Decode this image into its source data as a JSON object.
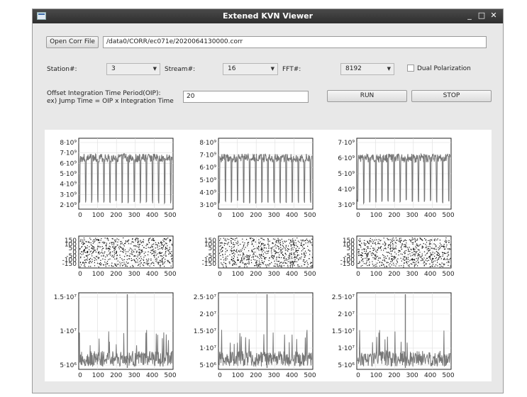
{
  "window": {
    "title": "Extened KVN Viewer"
  },
  "window_controls": {
    "minimize": "_",
    "maximize": "□",
    "close": "✕"
  },
  "toolbar": {
    "open_label": "Open Corr File",
    "file_path": "/data0/CORR/ec071e/2020064130000.corr"
  },
  "settings": {
    "station_label": "Station#:",
    "station_value": "3",
    "stream_label": "Stream#:",
    "stream_value": "16",
    "fft_label": "FFT#:",
    "fft_value": "8192",
    "dual_pol_label": "Dual Polarization",
    "dual_pol_checked": false
  },
  "oip": {
    "label_line1": "Offset Integration Time Period(OIP):",
    "label_line2": "ex) Jump Time = OIP x Integration Time",
    "value": "20",
    "run_label": "RUN",
    "stop_label": "STOP"
  },
  "plots": {
    "x_ticks": [
      "0",
      "100",
      "200",
      "300",
      "400",
      "500"
    ],
    "row1": [
      {
        "y_ticks": [
          "8·10⁹",
          "7·10⁹",
          "6·10⁹",
          "5·10⁹",
          "4·10⁹",
          "3·10⁹",
          "2·10⁹"
        ]
      },
      {
        "y_ticks": [
          "8·10⁹",
          "7·10⁹",
          "6·10⁹",
          "5·10⁹",
          "4·10⁹",
          "3·10⁹"
        ]
      },
      {
        "y_ticks": [
          "7·10⁹",
          "6·10⁹",
          "5·10⁹",
          "4·10⁹",
          "3·10⁹"
        ]
      }
    ],
    "row2": [
      {
        "y_ticks": [
          "150",
          "100",
          "50",
          "0",
          "-50",
          "-100",
          "-150"
        ]
      },
      {
        "y_ticks": [
          "150",
          "100",
          "50",
          "0",
          "-50",
          "-100",
          "-150"
        ]
      },
      {
        "y_ticks": [
          "150",
          "100",
          "50",
          "0",
          "-50",
          "-100",
          "-150"
        ]
      }
    ],
    "row3": [
      {
        "y_ticks": [
          "1.5·10⁷",
          "1·10⁷",
          "5·10⁶"
        ]
      },
      {
        "y_ticks": [
          "2.5·10⁷",
          "2·10⁷",
          "1.5·10⁷",
          "1·10⁷",
          "5·10⁶"
        ]
      },
      {
        "y_ticks": [
          "2.5·10⁷",
          "2·10⁷",
          "1.5·10⁷",
          "1·10⁷",
          "5·10⁶"
        ]
      }
    ]
  },
  "colors": {
    "trace": "#777777",
    "phase": "#111111",
    "grid": "#dddddd"
  }
}
